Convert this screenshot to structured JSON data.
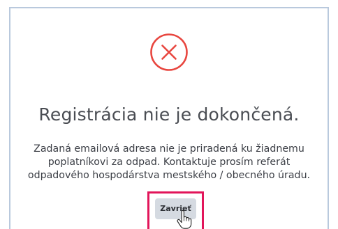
{
  "dialog": {
    "title": "Registrácia nie je dokončená.",
    "message_lines": [
      "Zadaná emailová adresa nie je priradená ku žiadnemu",
      "poplatníkovi za odpad. Kontaktuje prosím referát",
      "odpadového hospodárstva mestského / obecného úradu."
    ],
    "close_label": "Zavrieť",
    "status_icon": "error-x-circle-icon",
    "cursor_icon": "hand-pointer-icon"
  },
  "colors": {
    "error_red": "#e8463f",
    "highlight": "#e2155a",
    "button_bg": "#d5dae1",
    "frame_border": "#b9c9dd",
    "text": "#4a4d53"
  }
}
